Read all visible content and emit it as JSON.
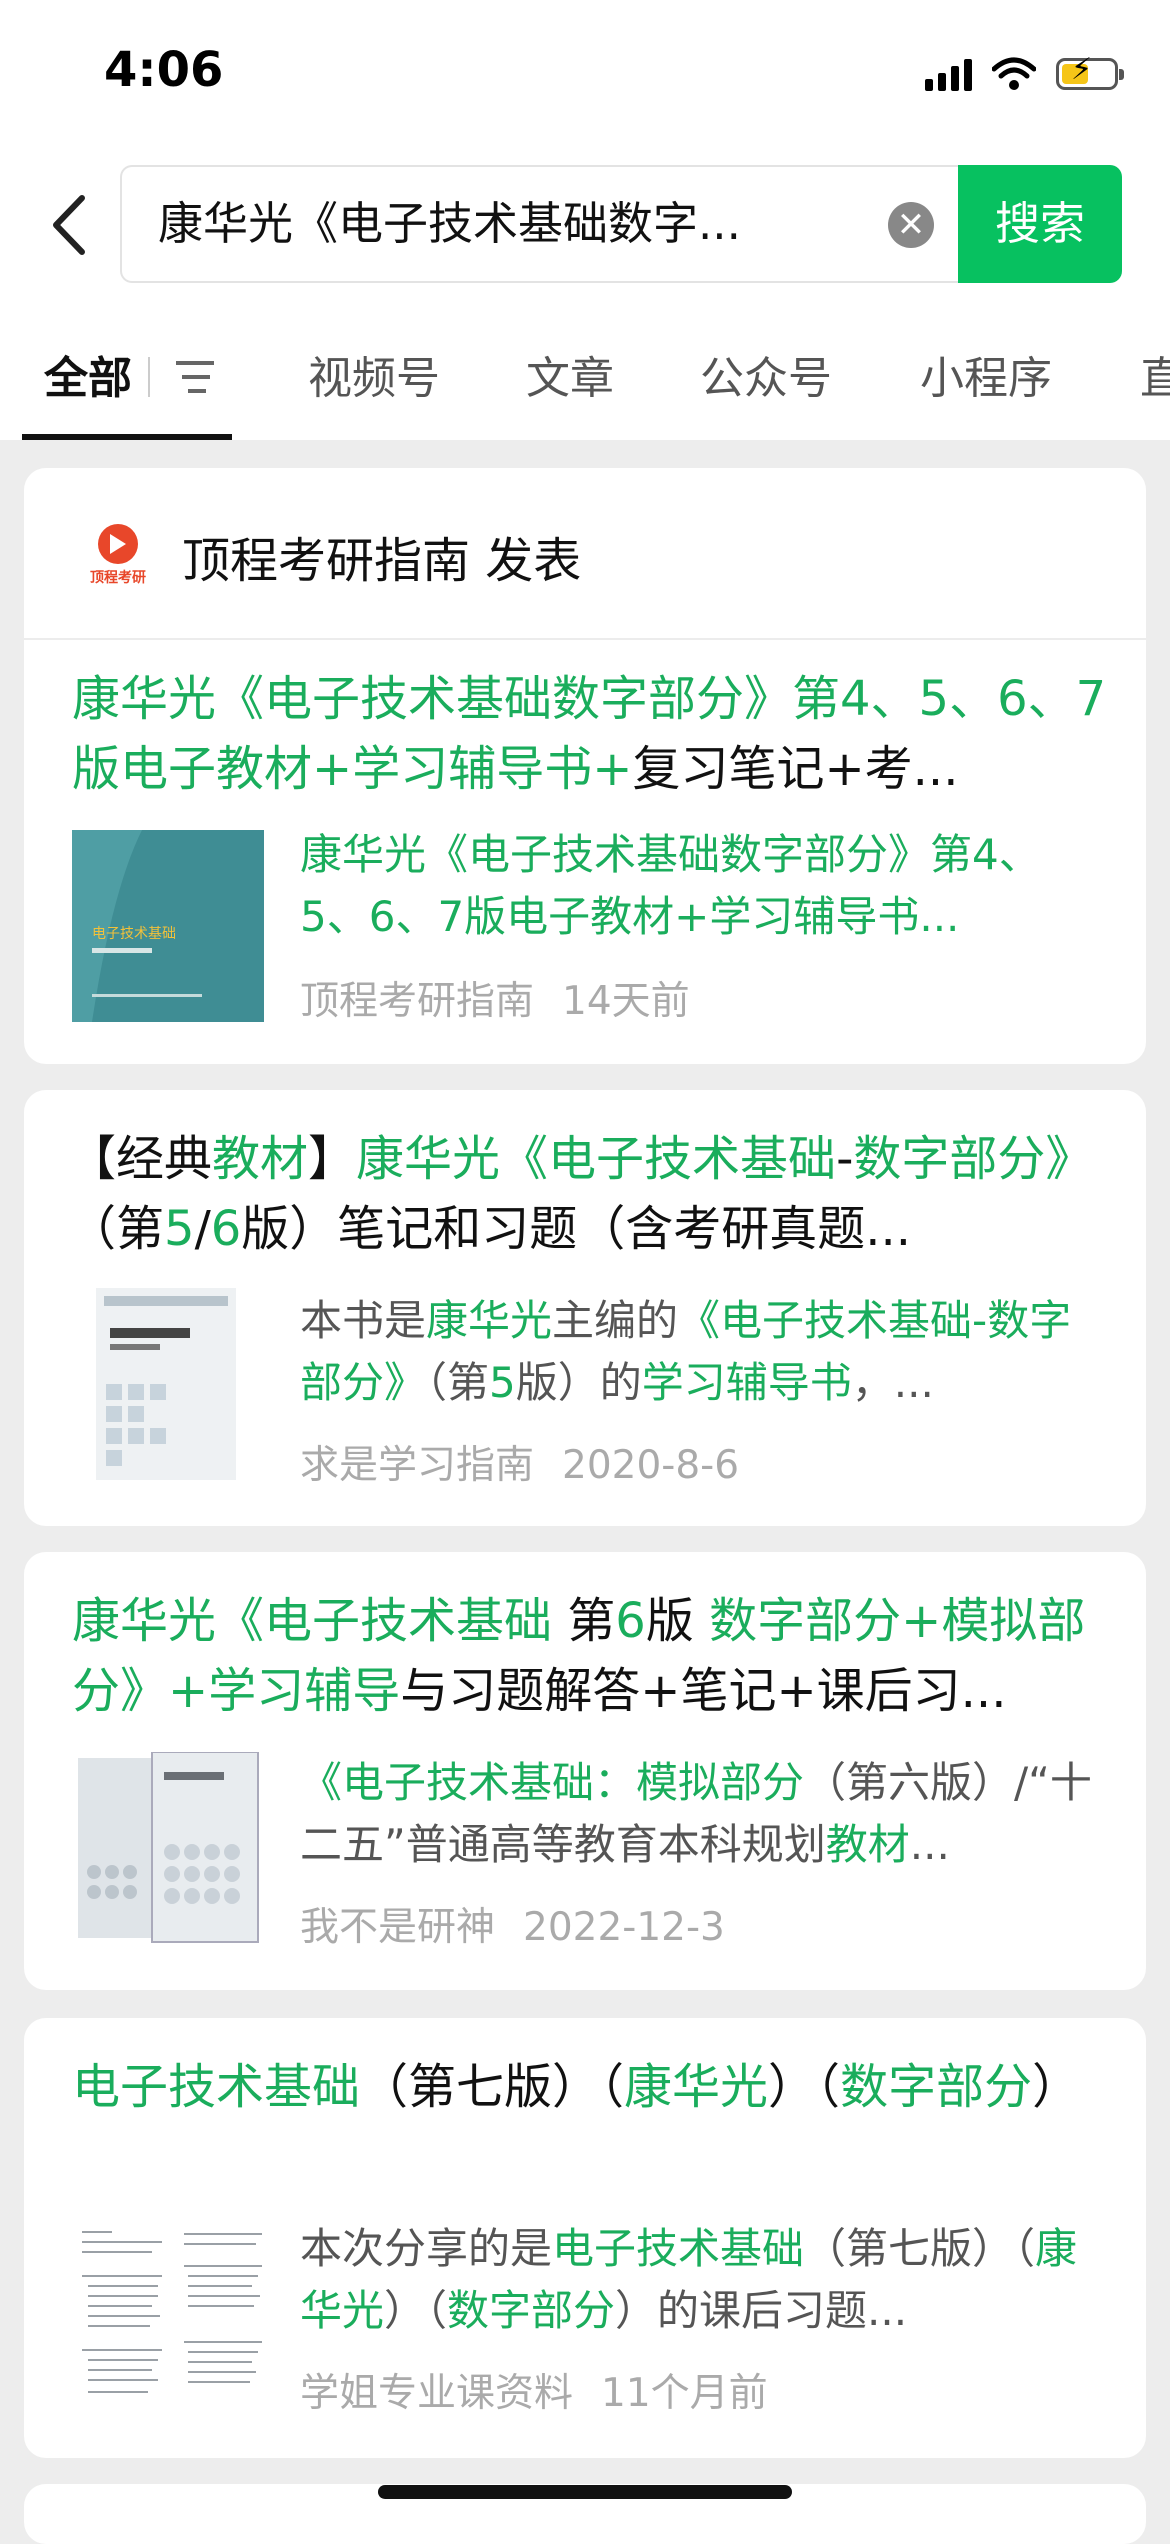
{
  "status_bar": {
    "time": "4:06"
  },
  "search": {
    "query": "康华光《电子技术基础数字...",
    "button_label": "搜索",
    "clear_label": "✕"
  },
  "tabs": [
    {
      "label": "全部",
      "active": true
    },
    {
      "label": "视频号"
    },
    {
      "label": "文章"
    },
    {
      "label": "公众号"
    },
    {
      "label": "小程序"
    },
    {
      "label": "直"
    }
  ],
  "results": [
    {
      "account": {
        "name": "顶程考研指南 发表",
        "logo_text": "顶程考研"
      },
      "title_parts": [
        {
          "t": "康华光《电子技术基础数字部分》第4、5、6、7版电子教材+学习辅导书+",
          "h": true
        },
        {
          "t": "复习笔记+考...",
          "h": false
        }
      ],
      "desc_parts": [
        {
          "t": "康华光《电子技术基础数字部分》第4、5、6、7版电子教材+学习辅导书...",
          "h": true
        }
      ],
      "source": "顶程考研指南",
      "date": "14天前",
      "thumb_text": "电子技术基础"
    },
    {
      "title_parts": [
        {
          "t": "【经典",
          "h": false
        },
        {
          "t": "教材",
          "h": true
        },
        {
          "t": "】",
          "h": false
        },
        {
          "t": "康华光《电子技术基础",
          "h": true
        },
        {
          "t": "-",
          "h": false
        },
        {
          "t": "数字部分》",
          "h": true
        },
        {
          "t": "（第",
          "h": false
        },
        {
          "t": "5",
          "h": true
        },
        {
          "t": "/",
          "h": false
        },
        {
          "t": "6",
          "h": true
        },
        {
          "t": "版）笔记和习题（含考研真题...",
          "h": false
        }
      ],
      "desc_parts": [
        {
          "t": "本书是",
          "h": false
        },
        {
          "t": "康华光",
          "h": true
        },
        {
          "t": "主编的",
          "h": false
        },
        {
          "t": "《电子技术基础-数字部分》",
          "h": true
        },
        {
          "t": "（第",
          "h": false
        },
        {
          "t": "5",
          "h": true
        },
        {
          "t": "版）的",
          "h": false
        },
        {
          "t": "学习辅导书",
          "h": true
        },
        {
          "t": "，...",
          "h": false
        }
      ],
      "source": "求是学习指南",
      "date": "2020-8-6"
    },
    {
      "title_parts": [
        {
          "t": "康华光《电子技术基础 ",
          "h": true
        },
        {
          "t": "第",
          "h": false
        },
        {
          "t": "6",
          "h": true
        },
        {
          "t": "版 ",
          "h": false
        },
        {
          "t": "数字部分+模拟部分》+学习辅导",
          "h": true
        },
        {
          "t": "与习题解答+笔记+课后习...",
          "h": false
        }
      ],
      "desc_parts": [
        {
          "t": "《电子技术基础：模拟部分",
          "h": true
        },
        {
          "t": "（第六版）/“十二五”普通高等教育本科规划",
          "h": false
        },
        {
          "t": "教材",
          "h": true
        },
        {
          "t": "...",
          "h": false
        }
      ],
      "source": "我不是研神",
      "date": "2022-12-3"
    },
    {
      "title_parts": [
        {
          "t": "电子技术基础",
          "h": true
        },
        {
          "t": "（第七版）（",
          "h": false
        },
        {
          "t": "康华光",
          "h": true
        },
        {
          "t": "）（",
          "h": false
        },
        {
          "t": "数字部分",
          "h": true
        },
        {
          "t": "）",
          "h": false
        }
      ],
      "desc_parts": [
        {
          "t": "本次分享的是",
          "h": false
        },
        {
          "t": "电子技术基础",
          "h": true
        },
        {
          "t": "（第七版）（",
          "h": false
        },
        {
          "t": "康华光",
          "h": true
        },
        {
          "t": "）（",
          "h": false
        },
        {
          "t": "数字部分",
          "h": true
        },
        {
          "t": "）的课后习题...",
          "h": false
        }
      ],
      "source": "学姐专业课资料",
      "date": "11个月前"
    }
  ],
  "colors": {
    "accent": "#07c160",
    "highlight": "#1aad5c",
    "background": "#ededed"
  }
}
